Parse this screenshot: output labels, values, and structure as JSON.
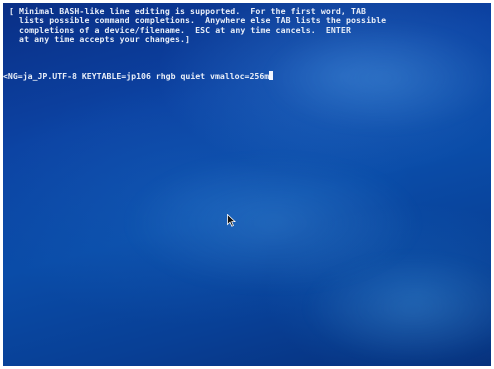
{
  "help_text": [
    "[ Minimal BASH-like line editing is supported.  For the first word, TAB",
    "  lists possible command completions.  Anywhere else TAB lists the possible",
    "  completions of a device/filename.  ESC at any time cancels.  ENTER",
    "  at any time accepts your changes.]"
  ],
  "command_line": "<NG=ja_JP.UTF-8 KEYTABLE=jp106 rhgb quiet vmalloc=256m",
  "icons": {
    "cursor": "text-cursor-icon",
    "pointer": "mouse-pointer-icon"
  }
}
